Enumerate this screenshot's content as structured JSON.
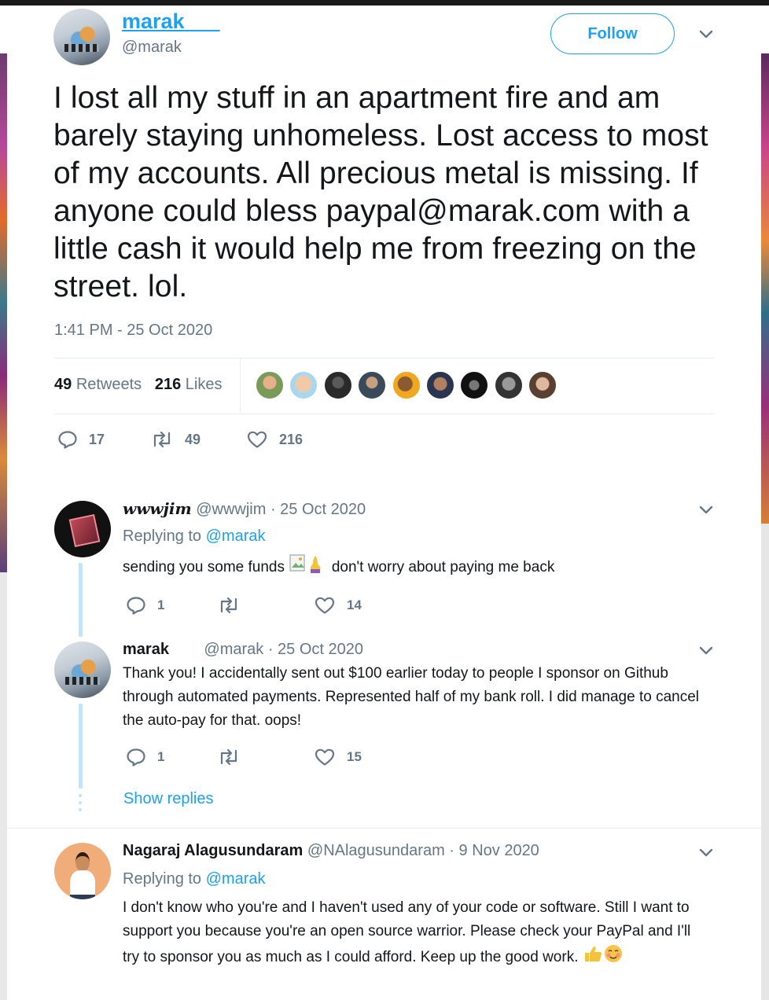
{
  "colors": {
    "accent": "#1da1f2",
    "muted": "#657786",
    "text": "#14171a",
    "thread": "#c4e3f8"
  },
  "tweet": {
    "author_name": "marak",
    "author_handle": "@marak",
    "follow_label": "Follow",
    "text": "I lost all my stuff in an apartment fire and am barely staying unhomeless. Lost access to most of my accounts. All precious metal is missing. If anyone could bless paypal@marak.com with a little cash it would help me from freezing on the street. lol.",
    "timestamp": "1:41 PM - 25 Oct 2020",
    "retweet_count": "49",
    "retweet_label": "Retweets",
    "like_count": "216",
    "like_label": "Likes",
    "likers_count": 9,
    "actions": {
      "replies": "17",
      "retweets": "49",
      "likes": "216"
    }
  },
  "replies": [
    {
      "name": "wwwjim",
      "handle": "@wwwjim",
      "date": "· 25 Oct 2020",
      "replying_prefix": "Replying to",
      "replying_to": "@marak",
      "text_before": "sending you some funds",
      "text_after": "don't worry about paying me back",
      "emoji_icons": [
        "broken-image-icon",
        "praying-hands-emoji"
      ],
      "actions": {
        "replies": "1",
        "likes": "14"
      }
    },
    {
      "name": "marak",
      "handle": "@marak",
      "date": "· 25 Oct 2020",
      "text": "Thank you! I accidentally sent out $100 earlier today to people I sponsor on Github through automated payments. Represented half of my bank roll. I did manage to cancel the auto-pay for that. oops!",
      "actions": {
        "replies": "1",
        "likes": "15"
      },
      "show_replies": "Show replies"
    },
    {
      "name": "Nagaraj Alagusundaram",
      "handle": "@NAlagusundaram",
      "date": "· 9 Nov 2020",
      "replying_prefix": "Replying to",
      "replying_to": "@marak",
      "text": "I don't know who you're and I haven't used any of your code or software. Still I want to support you because you're an open source warrior. Please check your PayPal and I'll try to sponsor you as much as I could afford. Keep up the good work.",
      "emoji_icons": [
        "thumbs-up-emoji",
        "smiling-face-emoji"
      ]
    }
  ]
}
